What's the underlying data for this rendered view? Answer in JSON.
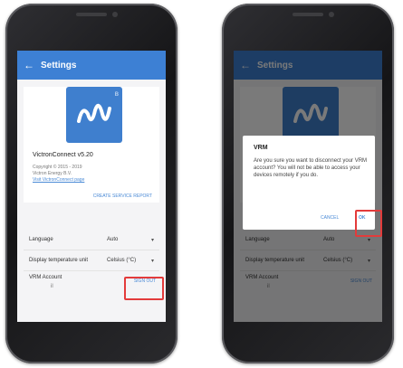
{
  "settings": {
    "title": "Settings",
    "back_icon": "←",
    "app_name": "VictronConnect v5.20",
    "copyright": "Copyright © 2015 - 2019",
    "company": "Victron Energy B.V.",
    "visit_link": "Visit VictronConnect page",
    "report_button": "CREATE SERVICE REPORT",
    "rows": [
      {
        "label": "Language",
        "value": "Auto",
        "caret": "▾"
      },
      {
        "label": "Display temperature unit",
        "value": "Celsius (°C)",
        "caret": "▾"
      }
    ],
    "vrm": {
      "label": "VRM Account",
      "sub": "il",
      "button": "SIGN OUT"
    }
  },
  "dialog": {
    "title": "VRM",
    "message": "Are you sure you want to disconnect your VRM account? You will not be able to access your devices remotely if you do.",
    "cancel": "CANCEL",
    "ok": "OK"
  },
  "highlight_color": "#e33b3b",
  "accent_color": "#3d80d4",
  "icons": {
    "bluetooth": "bluetooth-icon",
    "logo": "victron-logo"
  }
}
